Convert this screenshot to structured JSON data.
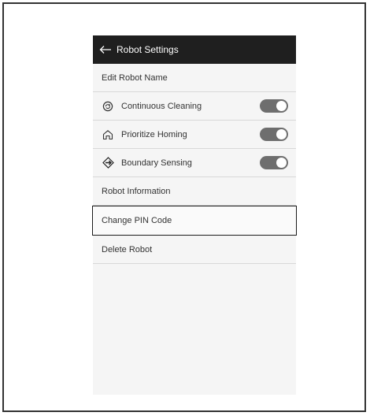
{
  "header": {
    "title": "Robot Settings"
  },
  "menu": {
    "edit_name": "Edit Robot Name",
    "continuous_cleaning": "Continuous Cleaning",
    "prioritize_homing": "Prioritize Homing",
    "boundary_sensing": "Boundary Sensing",
    "robot_information": "Robot Information",
    "change_pin": "Change PIN Code",
    "delete_robot": "Delete Robot"
  },
  "toggles": {
    "continuous_cleaning": "on",
    "prioritize_homing": "on",
    "boundary_sensing": "on"
  }
}
